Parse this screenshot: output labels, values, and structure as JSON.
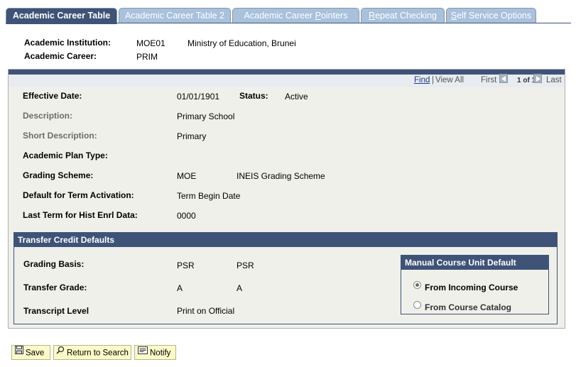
{
  "tabs": [
    {
      "label_pre": "Academic Career Table",
      "label_ul": "",
      "label_post": ""
    },
    {
      "label_pre": "Academic Career Table 2",
      "label_ul": "",
      "label_post": ""
    },
    {
      "label_pre": "Academic Career ",
      "label_ul": "P",
      "label_post": "ointers"
    },
    {
      "label_pre": "",
      "label_ul": "R",
      "label_post": "epeat Checking"
    },
    {
      "label_pre": "",
      "label_ul": "S",
      "label_post": "elf Service Options"
    }
  ],
  "key": {
    "institution_label": "Academic Institution:",
    "institution_code": "MOE01",
    "institution_name": "Ministry of Education, Brunei",
    "career_label": "Academic Career:",
    "career_code": "PRIM"
  },
  "nav": {
    "find": "Find",
    "separator": "|",
    "view_all": "View All",
    "first": "First",
    "count": "1 of 1",
    "last": "Last"
  },
  "fields": {
    "effective_date_label": "Effective Date:",
    "effective_date": "01/01/1901",
    "status_label": "Status:",
    "status": "Active",
    "description_label": "Description:",
    "description": "Primary School",
    "short_desc_label": "Short Description:",
    "short_desc": "Primary",
    "plan_type_label": "Academic Plan Type:",
    "grading_scheme_label": "Grading Scheme:",
    "grading_scheme_code": "MOE",
    "grading_scheme_name": "INEIS Grading Scheme",
    "default_term_label": "Default for Term Activation:",
    "default_term": "Term Begin Date",
    "last_term_label": "Last Term for Hist Enrl Data:",
    "last_term": "0000"
  },
  "transfer": {
    "title": "Transfer Credit Defaults",
    "grading_basis_label": "Grading Basis:",
    "grading_basis_code": "PSR",
    "grading_basis_desc": "PSR",
    "transfer_grade_label": "Transfer Grade:",
    "transfer_grade_code": "A",
    "transfer_grade_desc": "A",
    "transcript_label": "Transcript Level",
    "transcript_value": "Print on Official"
  },
  "manual_unit": {
    "title": "Manual Course Unit Default",
    "option1": "From Incoming Course",
    "option2": "From Course Catalog",
    "selected": "option1"
  },
  "buttons": {
    "save": "Save",
    "return": "Return to Search",
    "notify": "Notify"
  }
}
